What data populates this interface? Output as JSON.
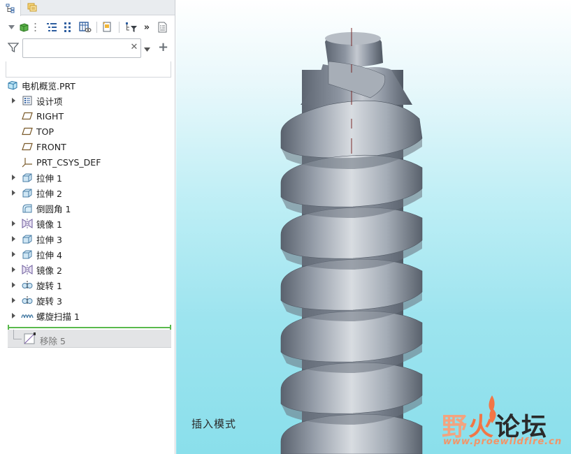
{
  "model_tree": {
    "root": {
      "label": "电机概览.PRT",
      "icon": "part-icon"
    },
    "items": [
      {
        "label": "设计项",
        "icon": "design-items-icon",
        "expandable": true
      },
      {
        "label": "RIGHT",
        "icon": "datum-plane-icon",
        "expandable": false
      },
      {
        "label": "TOP",
        "icon": "datum-plane-icon",
        "expandable": false
      },
      {
        "label": "FRONT",
        "icon": "datum-plane-icon",
        "expandable": false
      },
      {
        "label": "PRT_CSYS_DEF",
        "icon": "csys-icon",
        "expandable": false
      },
      {
        "label": "拉伸 1",
        "icon": "extrude-icon",
        "expandable": true
      },
      {
        "label": "拉伸 2",
        "icon": "extrude-icon",
        "expandable": true
      },
      {
        "label": "倒圆角 1",
        "icon": "round-icon",
        "expandable": false
      },
      {
        "label": "镜像 1",
        "icon": "mirror-icon",
        "expandable": true
      },
      {
        "label": "拉伸 3",
        "icon": "extrude-icon",
        "expandable": true
      },
      {
        "label": "拉伸 4",
        "icon": "extrude-icon",
        "expandable": true
      },
      {
        "label": "镜像 2",
        "icon": "mirror-icon",
        "expandable": true
      },
      {
        "label": "旋转 1",
        "icon": "revolve-icon",
        "expandable": true
      },
      {
        "label": "旋转 3",
        "icon": "revolve-icon",
        "expandable": true
      },
      {
        "label": "螺旋扫描 1",
        "icon": "helical-sweep-icon",
        "expandable": true
      }
    ],
    "suppressed_item": {
      "label": "移除 5",
      "icon": "remove-icon"
    }
  },
  "filter": {
    "value": "",
    "placeholder": ""
  },
  "viewport": {
    "mode_label": "插入模式"
  },
  "watermark": {
    "title_part1": "野",
    "title_part2": "火",
    "title_part3": "论坛",
    "url": "www.proewildfire.cn"
  },
  "colors": {
    "insert_line": "#59b94c",
    "model_surface": "#7e8794",
    "background_bottom": "#8adfeb"
  }
}
